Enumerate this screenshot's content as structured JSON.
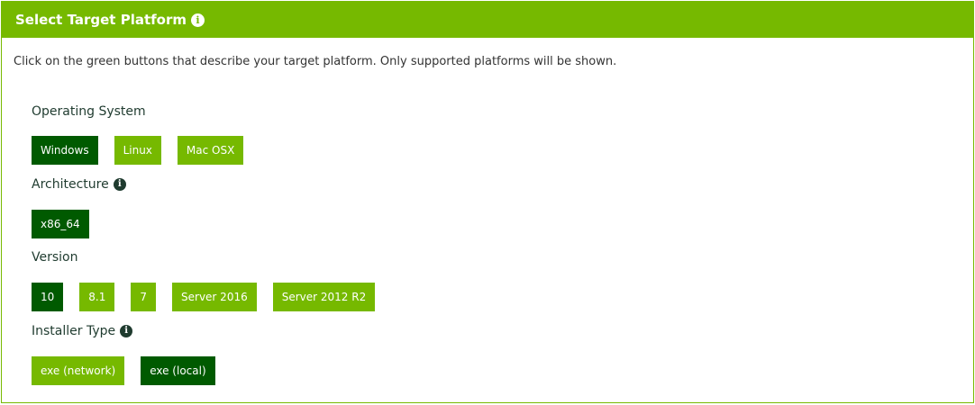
{
  "header": {
    "title": "Select Target Platform"
  },
  "intro": "Click on the green buttons that describe your target platform. Only supported platforms will be shown.",
  "colors": {
    "accent": "#76b900",
    "selected": "#005a00"
  },
  "sections": [
    {
      "label": "Operating System",
      "options": [
        "Windows",
        "Linux",
        "Mac OSX"
      ],
      "selected": "Windows"
    },
    {
      "label": "Architecture",
      "options": [
        "x86_64"
      ],
      "selected": "x86_64"
    },
    {
      "label": "Version",
      "options": [
        "10",
        "8.1",
        "7",
        "Server 2016",
        "Server 2012 R2"
      ],
      "selected": "10"
    },
    {
      "label": "Installer Type",
      "options": [
        "exe (network)",
        "exe (local)"
      ],
      "selected": "exe (local)"
    }
  ]
}
